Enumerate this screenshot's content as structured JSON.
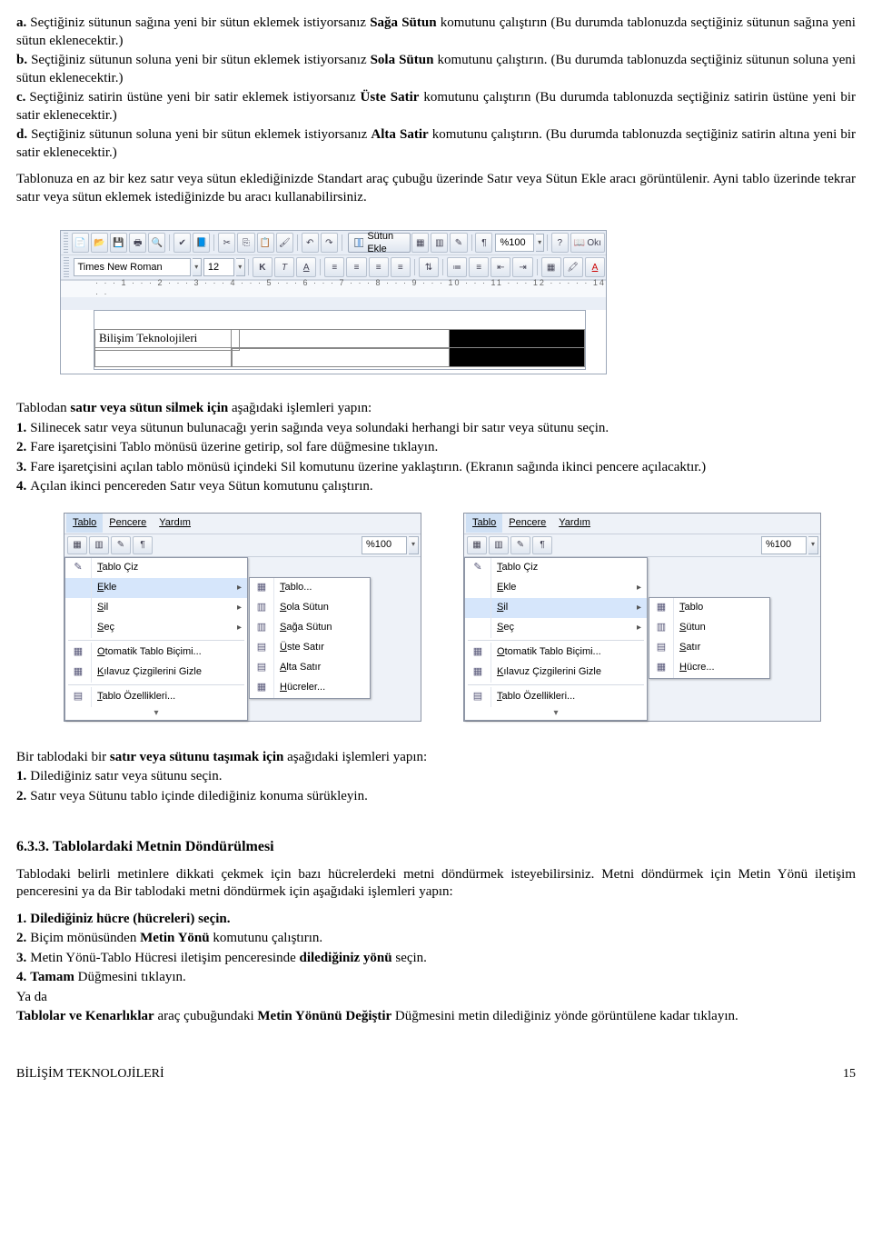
{
  "letters": {
    "a": {
      "label": "a.",
      "pre": "Seçtiğiniz sütunun sağına yeni bir sütun eklemek istiyorsanız ",
      "cmd": "Sağa Sütun",
      "post": " komutunu çalıştırın (Bu durumda tablonuzda seçtiğiniz sütunun sağına yeni sütun eklenecektir.)"
    },
    "b": {
      "label": "b.",
      "pre": "Seçtiğiniz sütunun soluna yeni bir sütun eklemek istiyorsanız ",
      "cmd": "Sola Sütun",
      "post": " komutunu çalıştırın. (Bu durumda tablonuzda seçtiğiniz sütunun soluna yeni sütun eklenecektir.)"
    },
    "c": {
      "label": "c.",
      "pre": "Seçtiğiniz satirin üstüne yeni bir satir eklemek istiyorsanız ",
      "cmd": "Üste Satir",
      "post": " komutunu çalıştırın (Bu durumda tablonuzda seçtiğiniz satirin üstüne yeni bir satir eklenecektir.)"
    },
    "d": {
      "label": "d.",
      "pre": "Seçtiğiniz sütunun soluna yeni bir sütun eklemek istiyorsanız ",
      "cmd": "Alta Satir",
      "post": " komutunu çalıştırın. (Bu durumda tablonuzda seçtiğiniz satirin altına yeni bir satir eklenecektir.)"
    }
  },
  "after_letters_p1": "Tablonuza en az bir kez satır veya sütun eklediğinizde Standart araç çubuğu üzerinde Satır veya Sütun Ekle aracı görüntülenir. Ayni tablo üzerinde tekrar satır veya sütun eklemek istediğinizde bu aracı kullanabilirsiniz.",
  "toolbar": {
    "font": "Times New Roman",
    "size": "12",
    "zoom": "%100",
    "sutun_ekle": "Sütun Ekle",
    "btnOk": "Okı",
    "ruler": "· · · 1 · · · 2 · · · 3 · · · 4 · · · 5 · · · 6 · · · 7 · · · 8 · · · 9 · · · 10 · · · 11 · · · 12 · · · · · 14 · ·",
    "cell_text": "Bilişim Teknolojileri",
    "fmt_k": "K",
    "fmt_t": "T",
    "fmt_a": "A"
  },
  "delete_intro": {
    "pre": "Tablodan ",
    "bold": "satır veya sütun silmek için",
    "post": " aşağıdaki işlemleri yapın:"
  },
  "delete_steps": [
    {
      "n": "1.",
      "t": "Silinecek satır veya sütunun bulunacağı yerin sağında veya solundaki herhangi bir satır veya sütunu seçin."
    },
    {
      "n": "2.",
      "t": "Fare işaretçisini Tablo mönüsü üzerine getirip, sol fare düğmesine tıklayın."
    },
    {
      "n": "3.",
      "t": "Fare işaretçisini açılan tablo mönüsü içindeki Sil komutunu üzerine yaklaştırın. (Ekranın sağında ikinci pencere açılacaktır.)"
    },
    {
      "n": "4.",
      "t": "Açılan ikinci pencereden Satır veya Sütun komutunu çalıştırın."
    }
  ],
  "menus": {
    "bar": [
      "Tablo",
      "Pencere",
      "Yardım"
    ],
    "items": [
      {
        "t": "Tablo Çiz",
        "ico": "✎"
      },
      {
        "t": "Ekle",
        "arr": true,
        "hl_in_left": true
      },
      {
        "t": "Sil",
        "arr": true,
        "hl_in_right": true
      },
      {
        "t": "Seç",
        "arr": true
      },
      {
        "sep": true
      },
      {
        "t": "Otomatik Tablo Biçimi...",
        "ico": "▦"
      },
      {
        "t": "Kılavuz Çizgilerini Gizle",
        "ico": "▦"
      },
      {
        "sep": true
      },
      {
        "t": "Tablo Özellikleri...",
        "ico": "▤"
      }
    ],
    "fly_left": [
      {
        "t": "Tablo...",
        "ico": "▦"
      },
      {
        "t": "Sola Sütun",
        "ico": "▥"
      },
      {
        "t": "Sağa Sütun",
        "ico": "▥"
      },
      {
        "t": "Üste Satır",
        "ico": "▤"
      },
      {
        "t": "Alta Satır",
        "ico": "▤"
      },
      {
        "t": "Hücreler...",
        "ico": "▦"
      }
    ],
    "fly_right": [
      {
        "t": "Tablo",
        "ico": "▦"
      },
      {
        "t": "Sütun",
        "ico": "▥"
      },
      {
        "t": "Satır",
        "ico": "▤"
      },
      {
        "t": "Hücre...",
        "ico": "▦"
      }
    ],
    "zoom": "%100"
  },
  "move_intro": {
    "pre": "Bir tablodaki bir ",
    "bold": "satır veya sütunu taşımak için",
    "post": " aşağıdaki işlemleri yapın:"
  },
  "move_steps": [
    {
      "n": "1.",
      "t": "Dilediğiniz satır veya sütunu seçin."
    },
    {
      "n": "2.",
      "t": "Satır veya Sütunu tablo içinde dilediğiniz konuma sürükleyin."
    }
  ],
  "section_title": "6.3.3. Tablolardaki Metnin Döndürülmesi",
  "rotate_intro": "Tablodaki belirli metinlere dikkati çekmek için bazı hücrelerdeki metni döndürmek isteyebilirsiniz. Metni döndürmek için Metin Yönü iletişim penceresini ya da Bir tablodaki metni döndürmek için aşağıdaki işlemleri yapın:",
  "rotate_steps": [
    {
      "n": "1.",
      "bold": "Dilediğiniz hücre (hücreleri) seçin."
    },
    {
      "n": "2.",
      "pre": "Biçim mönüsünden ",
      "bold": "Metin Yönü",
      "post": " komutunu çalıştırın."
    },
    {
      "n": "3.",
      "pre": "Metin Yönü-Tablo Hücresi iletişim penceresinde ",
      "bold": "dilediğiniz yönü",
      "post": " seçin."
    },
    {
      "n": "4.",
      "bold": "Tamam",
      "post": " Düğmesini tıklayın."
    }
  ],
  "rotate_tail_pre": "Ya da",
  "rotate_tail": {
    "b1": "Tablolar ve Kenarlıklar",
    "m": " araç çubuğundaki ",
    "b2": "Metin Yönünü Değiştir",
    "post": " Düğmesini metin dilediğiniz yönde görüntülene kadar tıklayın."
  },
  "footer_left": "BİLİŞİM TEKNOLOJİLERİ",
  "footer_right": "15"
}
